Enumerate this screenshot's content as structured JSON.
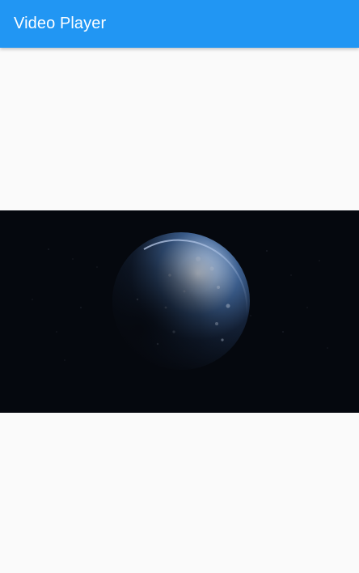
{
  "app_bar": {
    "title": "Video Player",
    "color": "#2196f3"
  },
  "video": {
    "background_color": "#05080e",
    "frame_description_icon": "earth-globe-icon"
  }
}
